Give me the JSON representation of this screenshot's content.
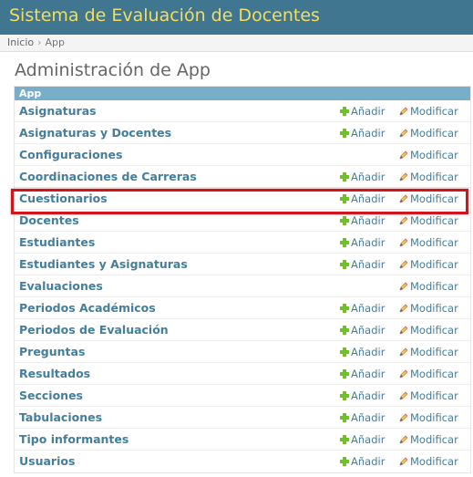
{
  "header": {
    "site_title": "Sistema de Evaluación de Docentes"
  },
  "breadcrumbs": {
    "home": "Inicio",
    "separator": "›",
    "current": "App"
  },
  "page_title": "Administración de App",
  "module": {
    "caption": "App",
    "add_label": "Añadir",
    "change_label": "Modificar",
    "rows": [
      {
        "name": "Asignaturas",
        "has_add": true
      },
      {
        "name": "Asignaturas y Docentes",
        "has_add": true
      },
      {
        "name": "Configuraciones",
        "has_add": false
      },
      {
        "name": "Coordinaciones de Carreras",
        "has_add": true
      },
      {
        "name": "Cuestionarios",
        "has_add": true
      },
      {
        "name": "Docentes",
        "has_add": true
      },
      {
        "name": "Estudiantes",
        "has_add": true
      },
      {
        "name": "Estudiantes y Asignaturas",
        "has_add": true
      },
      {
        "name": "Evaluaciones",
        "has_add": false
      },
      {
        "name": "Periodos Académicos",
        "has_add": true
      },
      {
        "name": "Periodos de Evaluación",
        "has_add": true
      },
      {
        "name": "Preguntas",
        "has_add": true
      },
      {
        "name": "Resultados",
        "has_add": true
      },
      {
        "name": "Secciones",
        "has_add": true
      },
      {
        "name": "Tabulaciones",
        "has_add": true
      },
      {
        "name": "Tipo informantes",
        "has_add": true
      },
      {
        "name": "Usuarios",
        "has_add": true
      }
    ]
  },
  "highlight": {
    "target_row": "Cuestionarios",
    "color": "#d0161d"
  },
  "colors": {
    "header_bg": "#417690",
    "title_yellow": "#f5dd5d",
    "caption_bg": "#79aec8",
    "link": "#447e9b",
    "add_green": "#70bf2b"
  }
}
